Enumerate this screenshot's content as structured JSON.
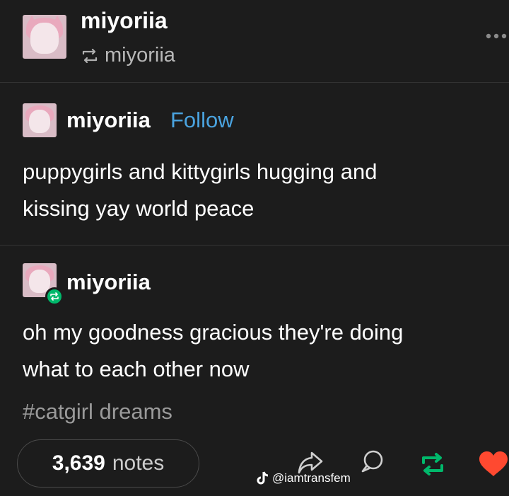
{
  "header": {
    "username": "miyoriia",
    "reblogged_from": "miyoriia",
    "more_icon": "ellipsis-icon"
  },
  "post1": {
    "username": "miyoriia",
    "follow_label": "Follow",
    "text_line1": "puppygirls and kittygirls hugging and",
    "text_line2": "kissing yay world peace"
  },
  "post2": {
    "username": "miyoriia",
    "text_line1": "oh my goodness gracious they're doing",
    "text_line2": "what to each other now",
    "tag": "#catgirl dreams"
  },
  "footer": {
    "notes_count": "3,639",
    "notes_label": "notes",
    "watermark": "@iamtransfem"
  },
  "colors": {
    "background": "#1c1c1c",
    "follow": "#4aa3df",
    "reblog_green": "#00b86b",
    "heart": "#ff4930",
    "muted": "#9a9a9a"
  }
}
